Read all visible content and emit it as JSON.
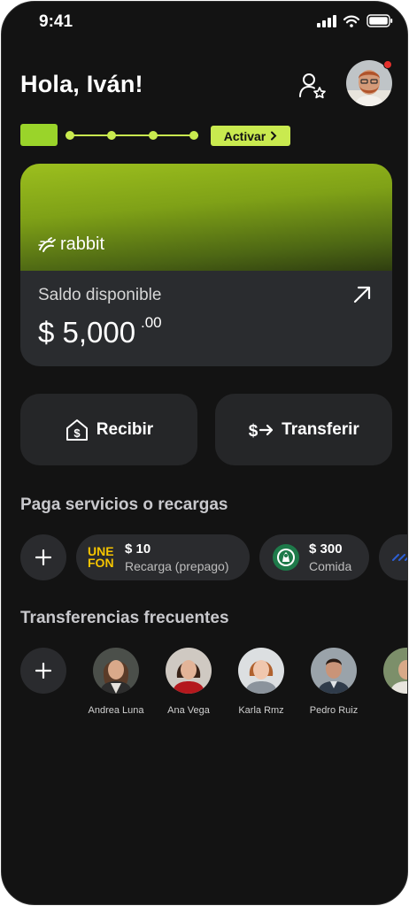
{
  "status_bar": {
    "time": "9:41"
  },
  "header": {
    "greeting": "Hola, Iván!"
  },
  "progress": {
    "activate_label": "Activar",
    "steps": 4
  },
  "card": {
    "brand": "rabbit",
    "balance_label": "Saldo disponible",
    "balance_amount": "$ 5,000",
    "balance_cents": ".00"
  },
  "actions": {
    "receive_label": "Recibir",
    "transfer_label": "Transferir"
  },
  "services": {
    "title": "Paga servicios o recargas",
    "items": [
      {
        "logo_text_1": "UNE",
        "logo_text_2": "FON",
        "amount": "$ 10",
        "label": "Recarga (prepago)"
      },
      {
        "logo": "starbucks-logo",
        "amount": "$ 300",
        "label": "Comida"
      }
    ]
  },
  "transfers": {
    "title": "Transferencias frecuentes",
    "contacts": [
      {
        "name": "Andrea Luna"
      },
      {
        "name": "Ana Vega"
      },
      {
        "name": "Karla Rmz"
      },
      {
        "name": "Pedro Ruiz"
      }
    ]
  },
  "colors": {
    "background": "#131313",
    "accent": "#c9ea4f",
    "accent_dark": "#9ad42a",
    "surface": "#252628",
    "notification": "#e5312d"
  }
}
